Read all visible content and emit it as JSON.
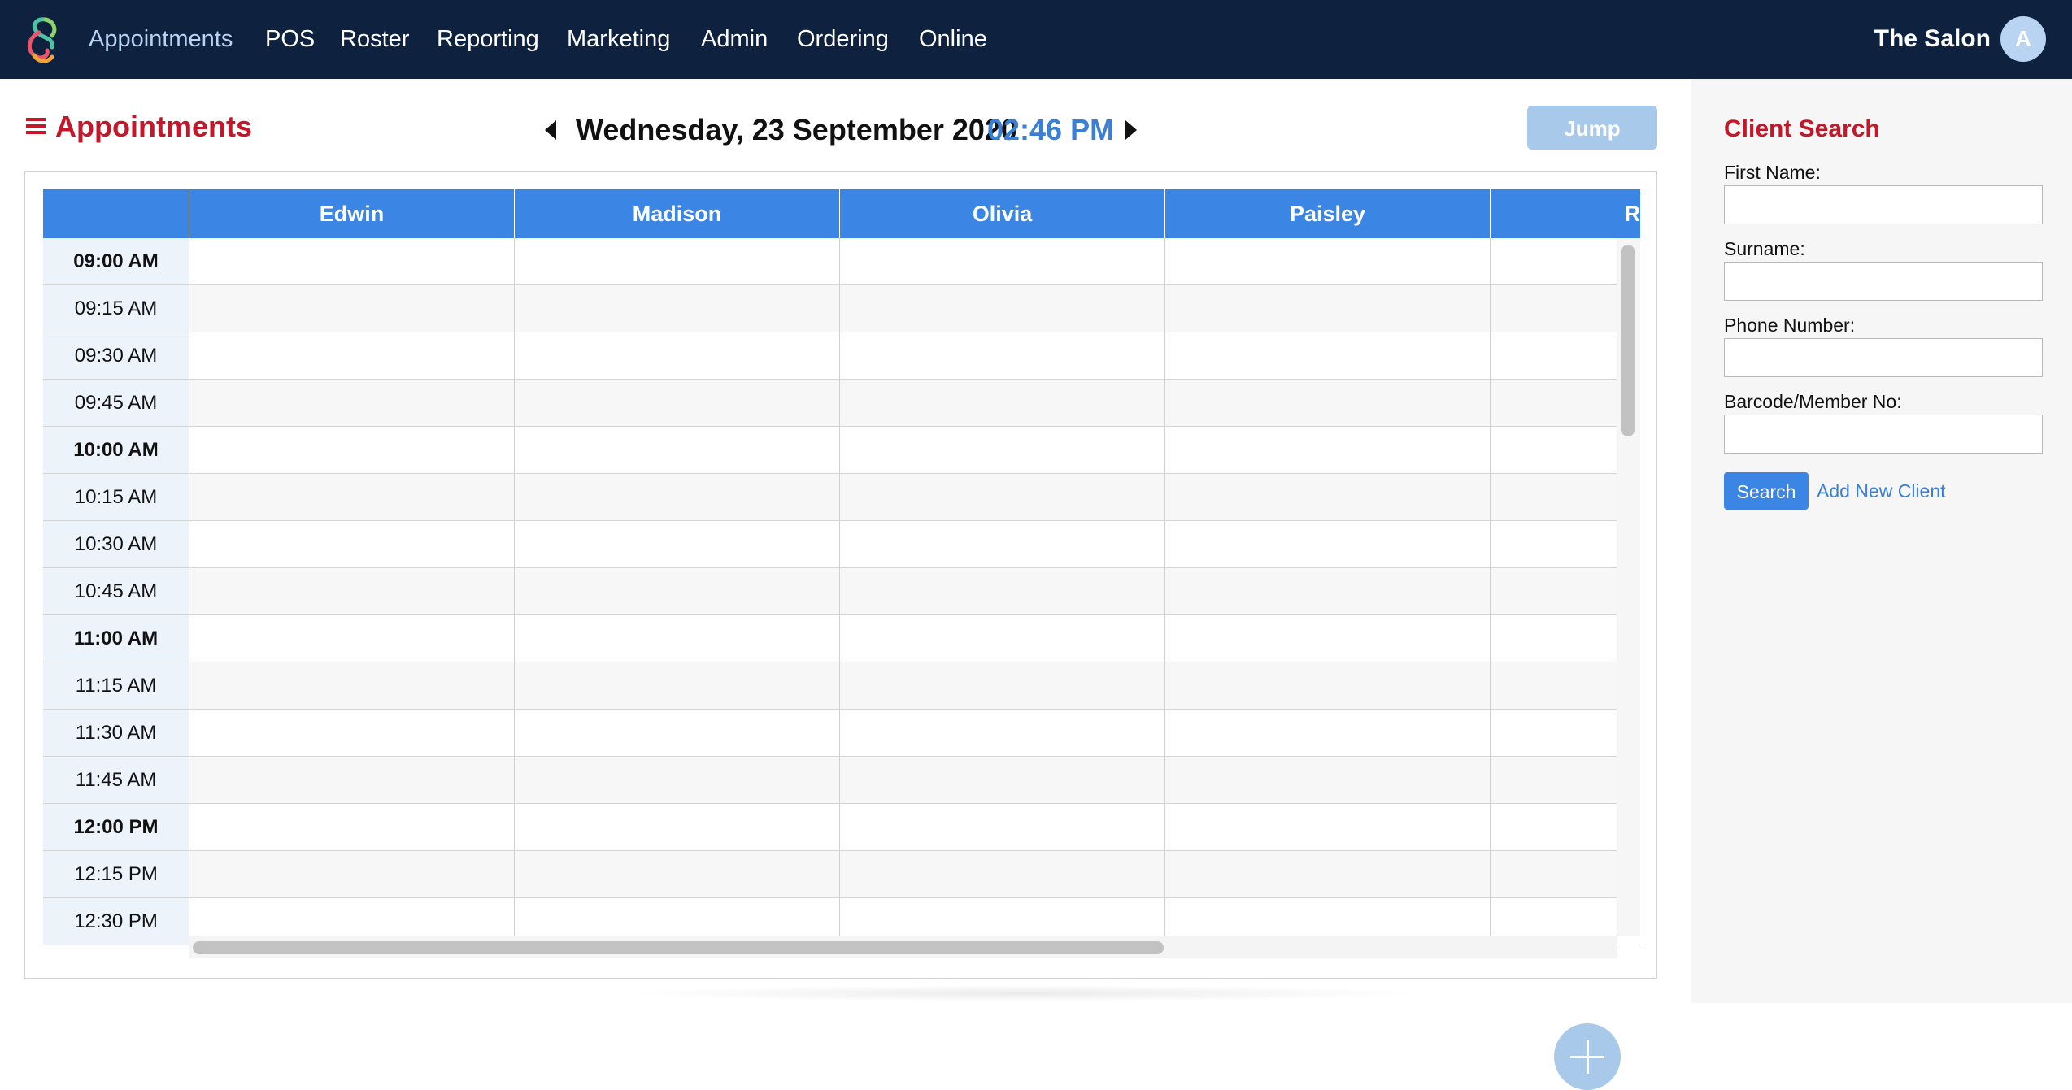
{
  "nav": {
    "items": [
      {
        "label": "Appointments",
        "active": true
      },
      {
        "label": "POS"
      },
      {
        "label": "Roster"
      },
      {
        "label": "Reporting"
      },
      {
        "label": "Marketing"
      },
      {
        "label": "Admin"
      },
      {
        "label": "Ordering"
      },
      {
        "label": "Online"
      }
    ],
    "business_name": "The Salon",
    "avatar_initial": "A"
  },
  "page": {
    "title": "Appointments",
    "date": "Wednesday, 23 September 2020",
    "time": "02:46 PM",
    "jump_label": "Jump"
  },
  "schedule": {
    "staff": [
      "Edwin",
      "Madison",
      "Olivia",
      "Paisley",
      "R"
    ],
    "times": [
      {
        "label": "09:00 AM",
        "hour": true
      },
      {
        "label": "09:15 AM"
      },
      {
        "label": "09:30 AM"
      },
      {
        "label": "09:45 AM"
      },
      {
        "label": "10:00 AM",
        "hour": true
      },
      {
        "label": "10:15 AM"
      },
      {
        "label": "10:30 AM"
      },
      {
        "label": "10:45 AM"
      },
      {
        "label": "11:00 AM",
        "hour": true
      },
      {
        "label": "11:15 AM"
      },
      {
        "label": "11:30 AM"
      },
      {
        "label": "11:45 AM"
      },
      {
        "label": "12:00 PM",
        "hour": true
      },
      {
        "label": "12:15 PM"
      },
      {
        "label": "12:30 PM"
      }
    ]
  },
  "client_search": {
    "title": "Client Search",
    "first_name_label": "First Name:",
    "first_name_value": "",
    "surname_label": "Surname:",
    "surname_value": "",
    "phone_label": "Phone Number:",
    "phone_value": "",
    "barcode_label": "Barcode/Member No:",
    "barcode_value": "",
    "search_label": "Search",
    "add_client_label": "Add New Client"
  },
  "colors": {
    "nav_bg": "#0e2240",
    "accent_red": "#c3182a",
    "accent_blue": "#3b86e5",
    "time_blue": "#3b7fd4",
    "disabled_blue": "#a9c9ea"
  },
  "icons": [
    "app-logo",
    "menu-icon",
    "prev-arrow-icon",
    "next-arrow-icon",
    "plus-icon"
  ]
}
